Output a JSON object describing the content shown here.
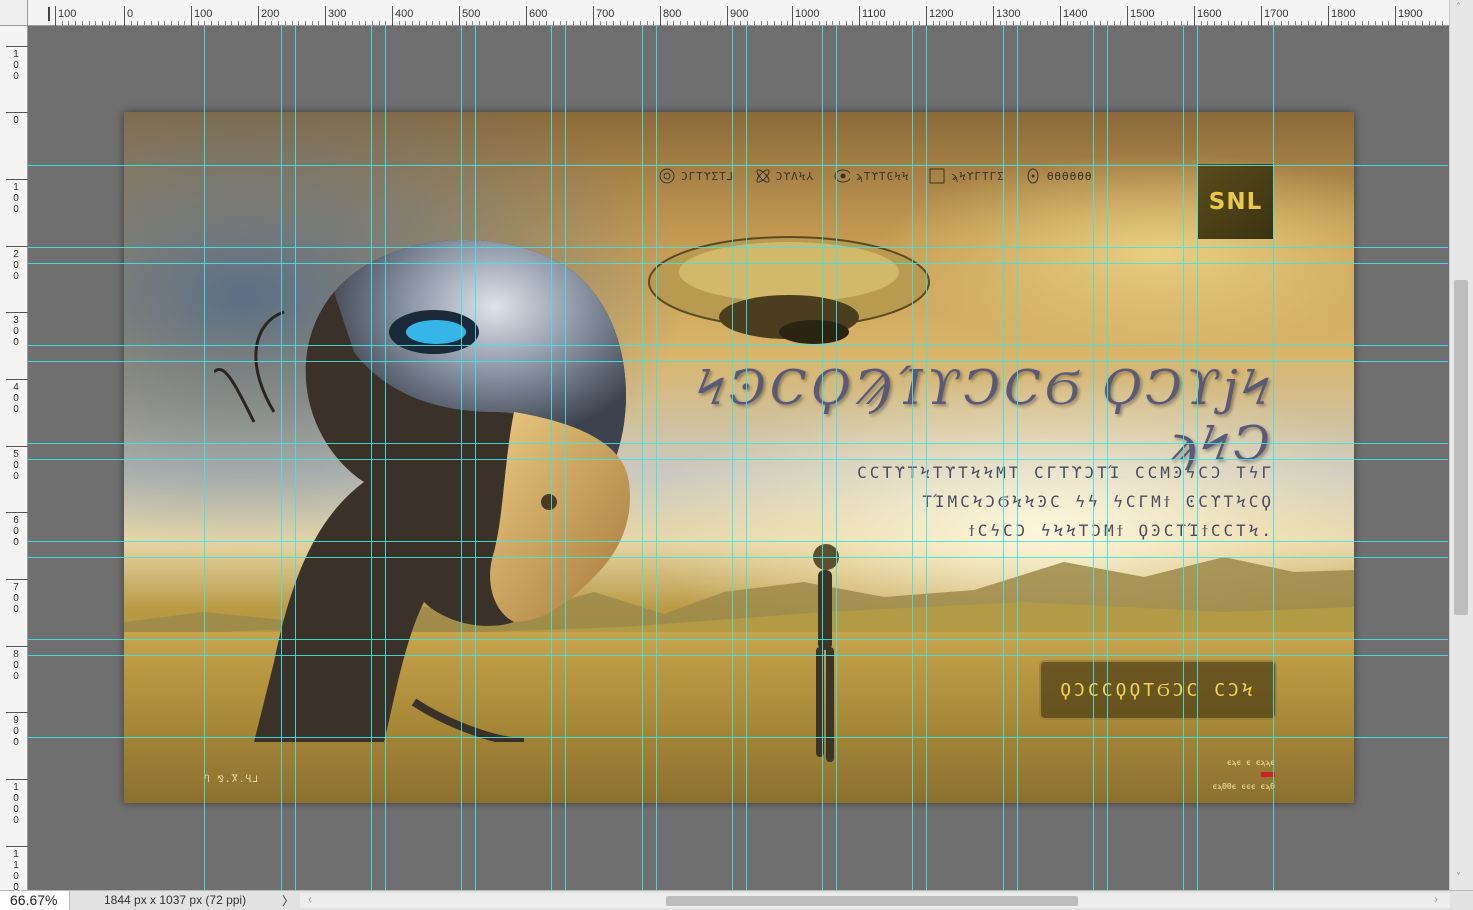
{
  "ruler": {
    "top_labels": [
      "100",
      "0",
      "100",
      "200",
      "300",
      "400",
      "500",
      "600",
      "700",
      "800",
      "900",
      "1000",
      "1100",
      "1200",
      "1300",
      "1400",
      "1500",
      "1600",
      "1700",
      "1800",
      "1900"
    ],
    "left_labels": [
      "100",
      "0",
      "100",
      "200",
      "300",
      "400",
      "500",
      "600",
      "700",
      "800",
      "900",
      "1000",
      "1100"
    ]
  },
  "artwork": {
    "nav_items": [
      {
        "icon": "circle-target-icon",
        "label": "ϽΓΤϒΣΤ⅃"
      },
      {
        "icon": "atom-icon",
        "label": "ϽϒΛϞ⅄"
      },
      {
        "icon": "eye-icon",
        "label": "ϡΤϒΤϾϞϞ"
      },
      {
        "icon": "square-icon",
        "label": "ϡϞϒΓΤΓΣ"
      },
      {
        "icon": "dot-circle-icon",
        "label": "ϴϴϴϴϴϴ"
      }
    ],
    "logo_text": "SNL",
    "headline": "ϞϿϹϘϠΊϒϽϹϬ ϘϽϒϳϞ ϡϞϽ",
    "subtext_lines": [
      "ϹϹΤϒΤϞΤϒΤϞϞΜΤ ϹΓΤϒϽΤΊ ϹϹΜϿϟϹϽ ΤϟΓ",
      "ΤΊΜϹϞϽϬϞϞϿϹ ϟϟ ϟϹΓΜϯ ϾϹϒΤϞϹϘ",
      "ϯϹϟϹϽ ϟϞϞΤϽΜϯ ϘϿϹΤΊϯϹϹΤϞ."
    ],
    "cta_label": "ϘϽϹϹϘϘΤϬϽϹ ϹϽϞ",
    "footer_left": "Ⴄ ⅋.Ⴟ.Ⴁ⅃",
    "footer_right_lines": [
      "ϵϡϵ ϵ ϵϡϡϵ",
      "ϵϡϴϴϵ ϵϵϵ ϵϡϴ"
    ]
  },
  "status": {
    "zoom": "66.67%",
    "doc_info": "1844 px x 1037 px (72 ppi)",
    "arrow": "〉"
  },
  "colors": {
    "guide": "#3fe3e6",
    "workspace": "#6f6f6f",
    "cta_text": "#f0d255",
    "logo_text": "#e9c94a"
  }
}
